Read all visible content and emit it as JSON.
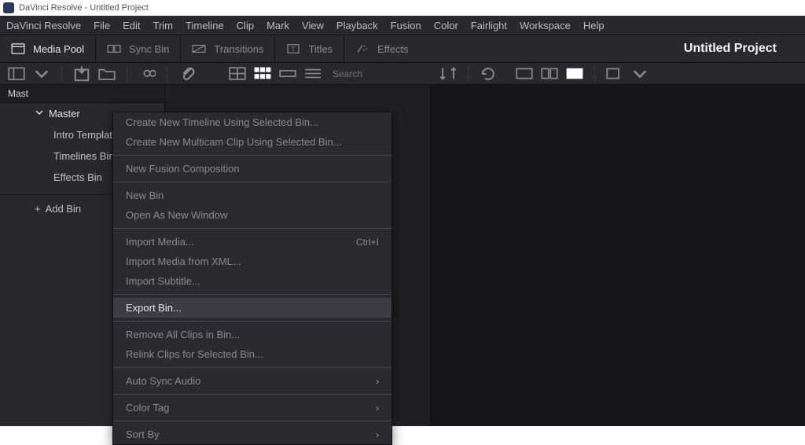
{
  "window": {
    "title": "DaVinci Resolve - Untitled Project"
  },
  "menubar": [
    "DaVinci Resolve",
    "File",
    "Edit",
    "Trim",
    "Timeline",
    "Clip",
    "Mark",
    "View",
    "Playback",
    "Fusion",
    "Color",
    "Fairlight",
    "Workspace",
    "Help"
  ],
  "toolbar": {
    "media_pool": "Media Pool",
    "sync_bin": "Sync Bin",
    "transitions": "Transitions",
    "titles": "Titles",
    "effects": "Effects",
    "project_title": "Untitled Project"
  },
  "subtoolbar": {
    "search_placeholder": "Search"
  },
  "sidebar": {
    "tab_label": "Master",
    "master_label": "Master",
    "items": [
      "Intro Template",
      "Timelines Bin",
      "Effects Bin"
    ],
    "add_bin": "Add Bin"
  },
  "context_menu": {
    "groups": [
      [
        {
          "label": "Create New Timeline Using Selected Bin...",
          "enabled": false
        },
        {
          "label": "Create New Multicam Clip Using Selected Bin...",
          "enabled": false
        }
      ],
      [
        {
          "label": "New Fusion Composition",
          "enabled": false
        }
      ],
      [
        {
          "label": "New Bin",
          "enabled": false
        },
        {
          "label": "Open As New Window",
          "enabled": false
        }
      ],
      [
        {
          "label": "Import Media...",
          "enabled": false,
          "shortcut": "Ctrl+I"
        },
        {
          "label": "Import Media from XML...",
          "enabled": false
        },
        {
          "label": "Import Subtitle...",
          "enabled": false
        }
      ],
      [
        {
          "label": "Export Bin...",
          "enabled": true,
          "highlight": true
        }
      ],
      [
        {
          "label": "Remove All Clips in Bin...",
          "enabled": false
        },
        {
          "label": "Relink Clips for Selected Bin...",
          "enabled": false
        }
      ],
      [
        {
          "label": "Auto Sync Audio",
          "enabled": false,
          "submenu": true
        }
      ],
      [
        {
          "label": "Color Tag",
          "enabled": false,
          "submenu": true
        }
      ],
      [
        {
          "label": "Sort By",
          "enabled": false,
          "submenu": true
        }
      ]
    ]
  }
}
